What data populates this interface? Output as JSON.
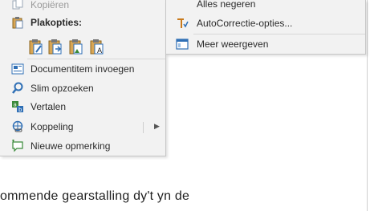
{
  "context_menu": {
    "kopieren": "Kopiëren",
    "paste_header": "Plakopties:",
    "paste_options": [
      "keep-source-formatting-icon",
      "merge-formatting-icon",
      "picture-icon",
      "keep-text-only-icon"
    ],
    "items": [
      {
        "label": "Documentitem invoegen",
        "icon": "document-item-icon"
      },
      {
        "label": "Slim opzoeken",
        "icon": "smart-lookup-icon"
      },
      {
        "label": "Vertalen",
        "icon": "translate-icon"
      },
      {
        "label": "Koppeling",
        "icon": "link-icon",
        "has_submenu": true
      },
      {
        "label": "Nieuwe opmerking",
        "icon": "new-comment-icon"
      }
    ]
  },
  "spelling_submenu": {
    "items": [
      {
        "label": "Alles negeren"
      },
      {
        "label": "AutoCorrectie-opties...",
        "icon": "autocorrect-icon"
      },
      {
        "label": "Meer weergeven",
        "icon": "more-view-icon"
      }
    ]
  },
  "document": {
    "text_line": "ommende gearstalling dy't yn de"
  },
  "colors": {
    "menu_bg": "#f2f2f2",
    "menu_border": "#c6c6c6",
    "icon_blue": "#2f6fb5",
    "icon_orange": "#c97a1c",
    "icon_green": "#3a8a3a"
  }
}
